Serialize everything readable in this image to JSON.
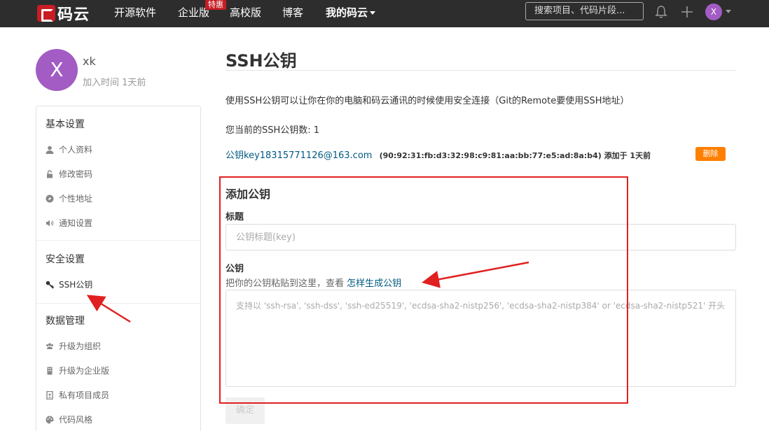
{
  "nav": {
    "logo_text": "码云",
    "items": [
      "开源软件",
      "企业版",
      "高校版",
      "博客",
      "我的码云"
    ],
    "hot_badge": "特惠",
    "search_placeholder": "搜索项目、代码片段...",
    "avatar_letter": "X",
    "colors": {
      "bg": "#2d2d2d",
      "brand": "#c71d23",
      "avatar": "#a25cc4"
    }
  },
  "profile": {
    "avatar_letter": "X",
    "name": "xk",
    "joined": "加入时间 1天前"
  },
  "sidebar": {
    "sections": [
      {
        "title": "基本设置",
        "items": [
          {
            "label": "个人资料",
            "icon": "user-icon"
          },
          {
            "label": "修改密码",
            "icon": "lock-icon"
          },
          {
            "label": "个性地址",
            "icon": "compass-icon"
          },
          {
            "label": "通知设置",
            "icon": "speaker-icon"
          }
        ]
      },
      {
        "title": "安全设置",
        "items": [
          {
            "label": "SSH公钥",
            "icon": "key-icon",
            "active": true
          }
        ]
      },
      {
        "title": "数据管理",
        "items": [
          {
            "label": "升级为组织",
            "icon": "users-icon"
          },
          {
            "label": "升级为企业版",
            "icon": "building-icon"
          },
          {
            "label": "私有项目成员",
            "icon": "member-icon"
          },
          {
            "label": "代码风格",
            "icon": "palette-icon"
          }
        ]
      }
    ]
  },
  "main": {
    "title": "SSH公钥",
    "description": "使用SSH公钥可以让你在你的电脑和码云通讯的时候使用安全连接（Git的Remote要使用SSH地址）",
    "count_text": "您当前的SSH公钥数: 1",
    "key": {
      "name": "公钥key18315771126@163.com",
      "fingerprint": "(90:92:31:fb:d3:32:98:c9:81:aa:bb:77:e5:ad:8a:b4) 添加于 1天前",
      "delete_label": "删除"
    },
    "add_form": {
      "heading": "添加公钥",
      "title_label": "标题",
      "title_placeholder": "公钥标题(key)",
      "key_label": "公钥",
      "hint_prefix": "把你的公钥粘贴到这里，查看 ",
      "hint_link": "怎样生成公钥",
      "key_placeholder": "支持以 'ssh-rsa', 'ssh-dss', 'ssh-ed25519', 'ecdsa-sha2-nistp256', 'ecdsa-sha2-nistp384' or 'ecdsa-sha2-nistp521' 开头",
      "submit_label": "确定"
    }
  },
  "annotations": {
    "color": "#e02020"
  }
}
